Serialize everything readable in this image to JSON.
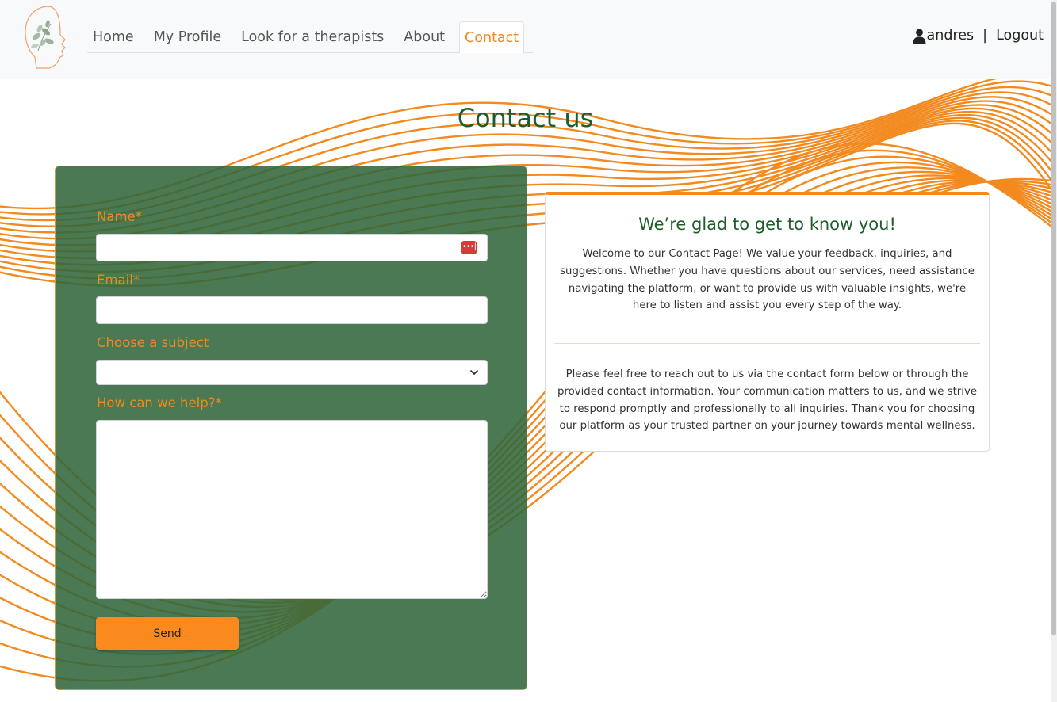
{
  "colors": {
    "accent_orange": "#f28a1f",
    "brand_green": "#1f5c2d",
    "form_background": "#31663b",
    "button": "#fa8a1e"
  },
  "nav": {
    "logo_icon": "leaf-face-logo-icon",
    "links": [
      {
        "label": "Home",
        "active": false
      },
      {
        "label": "My Profile",
        "active": false
      },
      {
        "label": "Look for a therapists",
        "active": false
      },
      {
        "label": "About",
        "active": false
      },
      {
        "label": "Contact",
        "active": true
      }
    ],
    "user_icon": "person-icon",
    "username": "andres",
    "separator": "|",
    "logout_label": "Logout"
  },
  "page": {
    "title": "Contact us"
  },
  "form": {
    "name_label": "Name*",
    "name_value": "",
    "name_badge_icon": "password-manager-icon",
    "email_label": "Email*",
    "email_value": "",
    "subject_label": "Choose a subject",
    "subject_selected": "---------",
    "message_label": "How can we help?*",
    "message_value": "",
    "send_label": "Send"
  },
  "info": {
    "heading": "We’re glad to get to know you!",
    "paragraph1": "Welcome to our Contact Page! We value your feedback, inquiries, and suggestions. Whether you have questions about our services, need assistance navigating the platform, or want to provide us with valuable insights, we're here to listen and assist you every step of the way.",
    "paragraph2": "Please feel free to reach out to us via the contact form below or through the provided contact information. Your communication matters to us, and we strive to respond promptly and professionally to all inquiries. Thank you for choosing our platform as your trusted partner on your journey towards mental wellness."
  }
}
